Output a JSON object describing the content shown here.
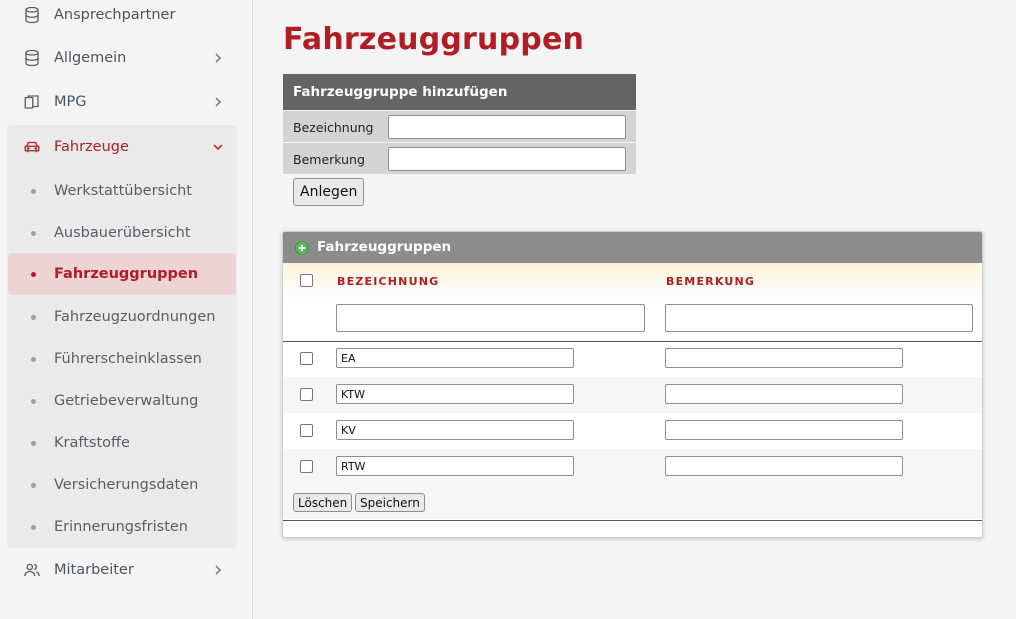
{
  "sidebar": {
    "items": [
      {
        "label": "Ansprechpartner",
        "icon": "database-icon"
      },
      {
        "label": "Allgemein",
        "icon": "database-icon"
      },
      {
        "label": "MPG",
        "icon": "devices-icon"
      },
      {
        "label": "Fahrzeuge",
        "icon": "car-icon"
      },
      {
        "label": "Mitarbeiter",
        "icon": "users-icon"
      }
    ],
    "sub_items": [
      {
        "label": "Werkstattübersicht"
      },
      {
        "label": "Ausbauerübersicht"
      },
      {
        "label": "Fahrzeuggruppen"
      },
      {
        "label": "Fahrzeugzuordnungen"
      },
      {
        "label": "Führerscheinklassen"
      },
      {
        "label": "Getriebeverwaltung"
      },
      {
        "label": "Kraftstoffe"
      },
      {
        "label": "Versicherungsdaten"
      },
      {
        "label": "Erinnerungsfristen"
      }
    ],
    "selected": "Fahrzeuggruppen"
  },
  "page": {
    "title": "Fahrzeuggruppen"
  },
  "add_form": {
    "header": "Fahrzeuggruppe hinzufügen",
    "fields": [
      {
        "label": "Bezeichnung",
        "value": ""
      },
      {
        "label": "Bemerkung",
        "value": ""
      }
    ],
    "submit_label": "Anlegen"
  },
  "grid": {
    "title": "Fahrzeuggruppen",
    "columns": [
      "BEZEICHNUNG",
      "BEMERKUNG"
    ],
    "rows": [
      {
        "bezeichnung": "EA",
        "bemerkung": ""
      },
      {
        "bezeichnung": "KTW",
        "bemerkung": ""
      },
      {
        "bezeichnung": "KV",
        "bemerkung": ""
      },
      {
        "bezeichnung": "RTW",
        "bemerkung": ""
      }
    ],
    "delete_label": "Löschen",
    "save_label": "Speichern"
  },
  "colors": {
    "accent": "#b01d24",
    "selected_bg": "#edd3d4",
    "panel_header": "#646464"
  }
}
